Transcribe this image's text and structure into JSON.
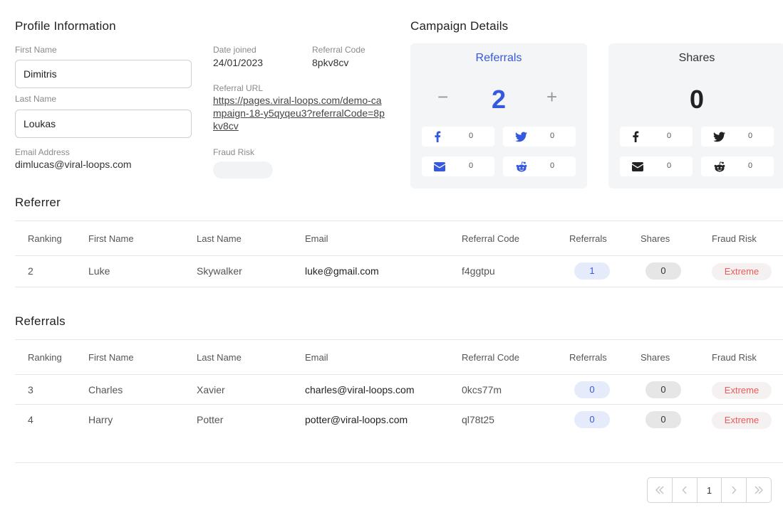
{
  "profile": {
    "title": "Profile Information",
    "first_name_label": "First Name",
    "first_name": "Dimitris",
    "last_name_label": "Last Name",
    "last_name": "Loukas",
    "email_label": "Email Address",
    "email": "dimlucas@viral-loops.com",
    "date_joined_label": "Date joined",
    "date_joined": "24/01/2023",
    "referral_code_label": "Referral Code",
    "referral_code": "8pkv8cv",
    "referral_url_label": "Referral URL",
    "referral_url": "https://pages.viral-loops.com/demo-campaign-18-y5qyqeu3?referralCode=8pkv8cv",
    "fraud_risk_label": "Fraud Risk"
  },
  "campaign": {
    "title": "Campaign Details",
    "referrals": {
      "title": "Referrals",
      "count": "2",
      "minus": "−",
      "plus": "+",
      "facebook": "0",
      "twitter": "0",
      "email": "0",
      "reddit": "0"
    },
    "shares": {
      "title": "Shares",
      "count": "0",
      "facebook": "0",
      "twitter": "0",
      "email": "0",
      "reddit": "0"
    }
  },
  "columns": [
    "Ranking",
    "First Name",
    "Last Name",
    "Email",
    "Referral Code",
    "Referrals",
    "Shares",
    "Fraud Risk"
  ],
  "referrer": {
    "title": "Referrer",
    "rows": [
      {
        "ranking": "2",
        "first": "Luke",
        "last": "Skywalker",
        "email": "luke@gmail.com",
        "code": "f4ggtpu",
        "referrals": "1",
        "shares": "0",
        "risk": "Extreme"
      }
    ]
  },
  "referrals": {
    "title": "Referrals",
    "rows": [
      {
        "ranking": "3",
        "first": "Charles",
        "last": "Xavier",
        "email": "charles@viral-loops.com",
        "code": "0kcs77m",
        "referrals": "0",
        "shares": "0",
        "risk": "Extreme"
      },
      {
        "ranking": "4",
        "first": "Harry",
        "last": "Potter",
        "email": "potter@viral-loops.com",
        "code": "ql78t25",
        "referrals": "0",
        "shares": "0",
        "risk": "Extreme"
      }
    ]
  },
  "pagination": {
    "first": "«",
    "prev": "‹",
    "current": "1",
    "next": "›",
    "last": "»"
  },
  "colors": {
    "accent_blue": "#3558e0",
    "extreme_red": "#ec5a5a",
    "card_bg": "#f3f5f6"
  }
}
